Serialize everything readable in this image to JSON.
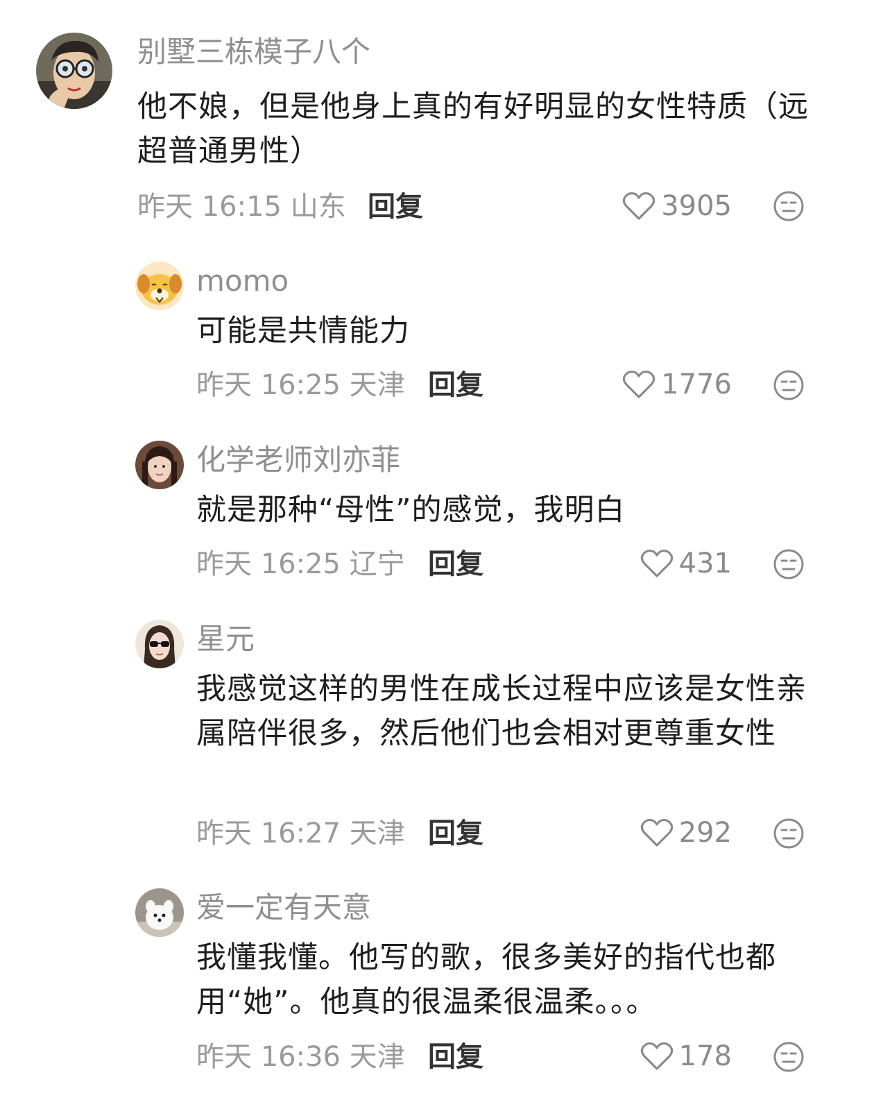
{
  "comments": [
    {
      "username": "别墅三栋模子八个",
      "content": "他不娘，但是他身上真的有好明显的女性特质（远超普通男性）",
      "time": "昨天 16:15",
      "location": "山东",
      "reply_label": "回复",
      "likes": "3905",
      "avatar_icon": "cartoon-man-glasses-avatar"
    },
    {
      "username": "momo",
      "content": "可能是共情能力",
      "time": "昨天 16:25",
      "location": "天津",
      "reply_label": "回复",
      "likes": "1776",
      "avatar_icon": "yellow-dog-avatar"
    },
    {
      "username": "化学老师刘亦菲",
      "content": "就是那种“母性”的感觉，我明白",
      "time": "昨天 16:25",
      "location": "辽宁",
      "reply_label": "回复",
      "likes": "431",
      "avatar_icon": "woman-photo-avatar"
    },
    {
      "username": "星元",
      "content": "我感觉这样的男性在成长过程中应该是女性亲属陪伴很多，然后他们也会相对更尊重女性",
      "time": "昨天 16:27",
      "location": "天津",
      "reply_label": "回复",
      "likes": "292",
      "avatar_icon": "woman-sunglasses-avatar"
    },
    {
      "username": "爱一定有天意",
      "content": "我懂我懂。他写的歌，很多美好的指代也都用“她”。他真的很温柔很温柔。。。",
      "time": "昨天 16:36",
      "location": "天津",
      "reply_label": "回复",
      "likes": "178",
      "avatar_icon": "white-dog-photo-avatar"
    }
  ],
  "icons": {
    "like": "heart-outline-icon",
    "dislike": "unamused-face-icon"
  },
  "colors": {
    "username": "#8f8f8f",
    "content": "#1e1e1e",
    "meta": "#9a9a9a",
    "reply": "#333333"
  }
}
